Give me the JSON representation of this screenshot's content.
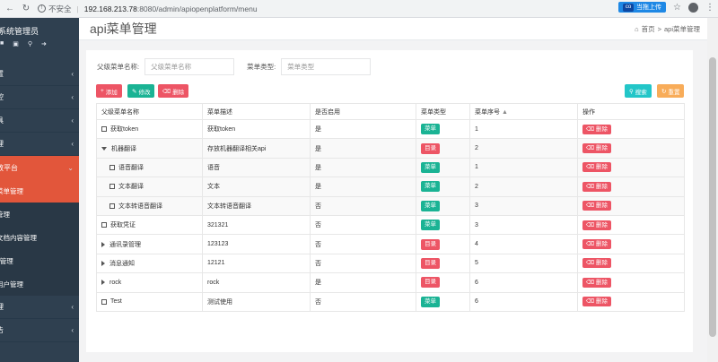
{
  "browser": {
    "insecure_label": "不安全",
    "url_host": "192.168.213.78",
    "url_path": ":8080/admin/apiopenplatform/menu",
    "screenshot_label": "当拖上传"
  },
  "sidebar": {
    "admin_name": "系统管理员",
    "items": [
      {
        "label": "置"
      },
      {
        "label": "控"
      },
      {
        "label": "具"
      },
      {
        "label": "理"
      },
      {
        "label": "放平台"
      }
    ],
    "subitems": [
      {
        "label": "菜单管理"
      },
      {
        "label": "管理"
      },
      {
        "label": "文档内容管理"
      },
      {
        "label": "k管理"
      },
      {
        "label": "用户管理"
      }
    ],
    "bottom_items": [
      {
        "label": "理"
      },
      {
        "label": "告"
      }
    ]
  },
  "page": {
    "title": "api菜单管理",
    "breadcrumb_home": "首页",
    "breadcrumb_current": "api菜单管理"
  },
  "search": {
    "parent_label": "父级菜单名称:",
    "parent_placeholder": "父级菜单名称",
    "type_label": "菜单类型:",
    "type_placeholder": "菜单类型"
  },
  "toolbar": {
    "add": "添加",
    "edit": "修改",
    "delete": "删除",
    "search": "搜索",
    "reset": "重置"
  },
  "table": {
    "headers": [
      "父级菜单名称",
      "菜单描述",
      "是否启用",
      "菜单类型",
      "菜单序号",
      "操作"
    ],
    "delete_label": "删除",
    "rows": [
      {
        "name": "获取token",
        "desc": "获取token",
        "enabled": "是",
        "type": "菜单",
        "order": "1",
        "level": 0,
        "node": "leaf"
      },
      {
        "name": "机器翻译",
        "desc": "存放机器翻译相关api",
        "enabled": "是",
        "type": "目录",
        "order": "2",
        "level": 0,
        "node": "open"
      },
      {
        "name": "语音翻译",
        "desc": "语音",
        "enabled": "是",
        "type": "菜单",
        "order": "1",
        "level": 1,
        "node": "leaf"
      },
      {
        "name": "文本翻译",
        "desc": "文本",
        "enabled": "是",
        "type": "菜单",
        "order": "2",
        "level": 1,
        "node": "leaf"
      },
      {
        "name": "文本转语音翻译",
        "desc": "文本转语音翻译",
        "enabled": "否",
        "type": "菜单",
        "order": "3",
        "level": 1,
        "node": "leaf"
      },
      {
        "name": "获取凭证",
        "desc": "321321",
        "enabled": "否",
        "type": "菜单",
        "order": "3",
        "level": 0,
        "node": "leaf"
      },
      {
        "name": "通讯录管理",
        "desc": "123123",
        "enabled": "否",
        "type": "目录",
        "order": "4",
        "level": 0,
        "node": "closed"
      },
      {
        "name": "消息通知",
        "desc": "12121",
        "enabled": "否",
        "type": "目录",
        "order": "5",
        "level": 0,
        "node": "closed"
      },
      {
        "name": "rock",
        "desc": "rock",
        "enabled": "是",
        "type": "目录",
        "order": "6",
        "level": 0,
        "node": "closed"
      },
      {
        "name": "Test",
        "desc": "测试使用",
        "enabled": "否",
        "type": "菜单",
        "order": "6",
        "level": 0,
        "node": "leaf"
      }
    ]
  },
  "colors": {
    "sidebar_bg": "#2f4050",
    "active_item": "#e2563b",
    "green": "#1ab394",
    "red": "#ed5565",
    "cyan": "#23c6c8",
    "orange": "#f8ac59"
  }
}
